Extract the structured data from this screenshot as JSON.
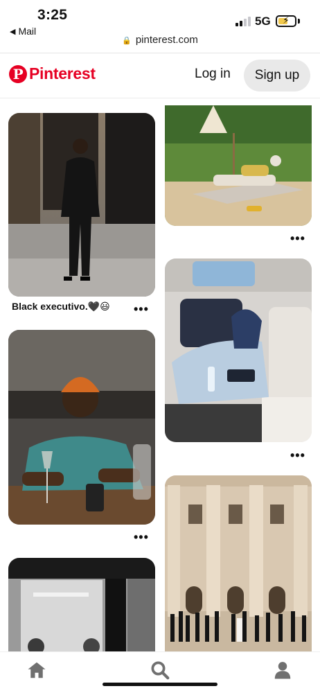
{
  "status": {
    "time": "3:25",
    "back_app": "Mail",
    "network": "5G",
    "url": "pinterest.com"
  },
  "header": {
    "brand": "Pinterest",
    "login_label": "Log in",
    "signup_label": "Sign up"
  },
  "pins": [
    {
      "subject": "man in black double-breasted suit",
      "caption": "Black executivo.🖤😃"
    },
    {
      "subject": "person reclining on sun lounger",
      "caption": ""
    },
    {
      "subject": "man in orange beanie at table",
      "caption": ""
    },
    {
      "subject": "person in car back seat",
      "caption": ""
    },
    {
      "subject": "black and white doorway scene",
      "caption": ""
    },
    {
      "subject": "group in front of columned building",
      "caption": ""
    }
  ],
  "more_label": "•••",
  "nav": {
    "home": "home-icon",
    "search": "search-icon",
    "profile": "profile-icon"
  },
  "colors": {
    "brand": "#e60023",
    "signup_bg": "#e9e9e9"
  }
}
